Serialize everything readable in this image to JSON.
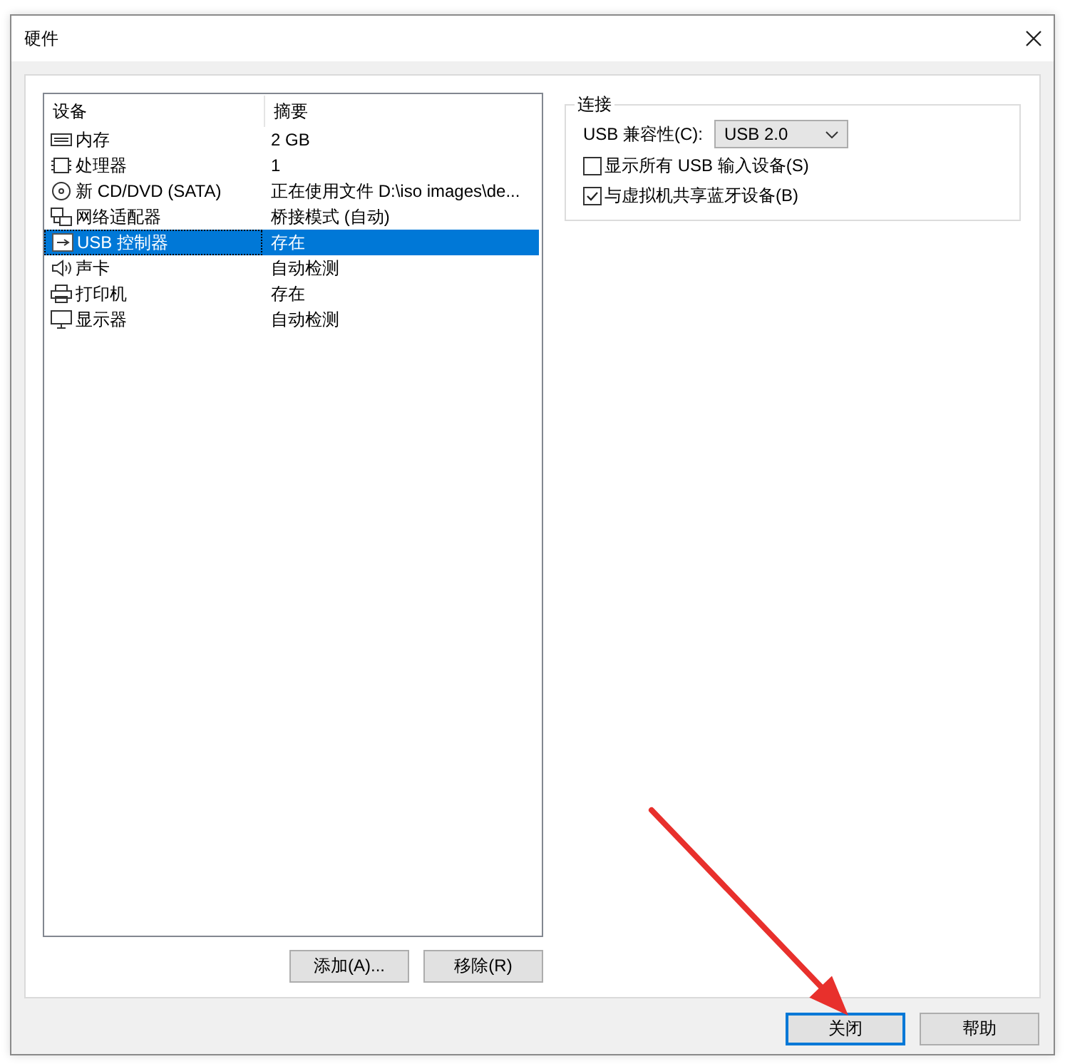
{
  "window": {
    "title": "硬件"
  },
  "device_list": {
    "columns": [
      "设备",
      "摘要"
    ],
    "rows": [
      {
        "kind": "memory",
        "name": "内存",
        "summary": "2 GB",
        "selected": false
      },
      {
        "kind": "cpu",
        "name": "处理器",
        "summary": "1",
        "selected": false
      },
      {
        "kind": "cdrom",
        "name": "新 CD/DVD (SATA)",
        "summary": "正在使用文件 D:\\iso images\\de...",
        "selected": false
      },
      {
        "kind": "network",
        "name": "网络适配器",
        "summary": "桥接模式 (自动)",
        "selected": false
      },
      {
        "kind": "usb",
        "name": "USB 控制器",
        "summary": "存在",
        "selected": true
      },
      {
        "kind": "sound",
        "name": "声卡",
        "summary": "自动检测",
        "selected": false
      },
      {
        "kind": "printer",
        "name": "打印机",
        "summary": "存在",
        "selected": false
      },
      {
        "kind": "display",
        "name": "显示器",
        "summary": "自动检测",
        "selected": false
      }
    ]
  },
  "list_buttons": [
    "添加(A)...",
    "移除(R)"
  ],
  "connection": {
    "title": "连接",
    "compat_label": "USB 兼容性(C):",
    "compat_value": "USB 2.0",
    "checkboxes": [
      {
        "label": "显示所有 USB 输入设备(S)",
        "checked": false
      },
      {
        "label": "与虚拟机共享蓝牙设备(B)",
        "checked": true
      }
    ]
  },
  "footer_buttons": [
    {
      "label": "关闭",
      "default": true
    },
    {
      "label": "帮助",
      "default": false
    }
  ]
}
